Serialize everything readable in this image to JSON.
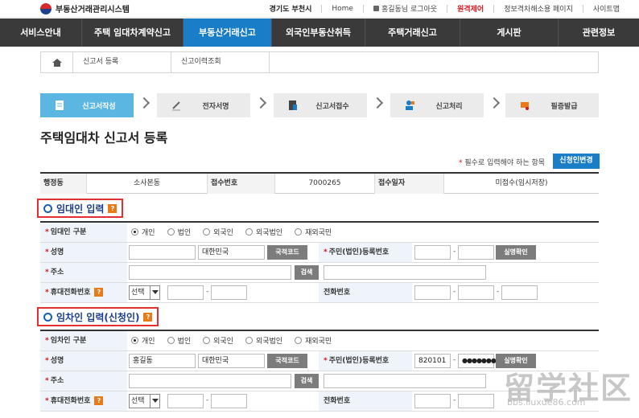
{
  "header": {
    "logo_text": "부동산거래관리시스템",
    "region": "경기도 부천시",
    "home": "Home",
    "user_logout": "홍길동님 로그아웃",
    "remote_control": "원격제어",
    "info_cancel": "정보격차해소용 페이지",
    "sitemap": "사이트맵"
  },
  "nav": {
    "items": [
      "서비스안내",
      "주택 임대차계약신고",
      "부동산거래신고",
      "외국인부동산취득",
      "주택거래신고",
      "게시판",
      "관련정보"
    ]
  },
  "breadcrumb": {
    "items": [
      "신고서 등록",
      "신고이력조회"
    ]
  },
  "steps": [
    "신고서작성",
    "전자서명",
    "신고서접수",
    "신고처리",
    "필증발급"
  ],
  "page": {
    "title": "주택임대차 신고서 등록",
    "required_note": "필수로 입력해야 하는 항목",
    "change_applicant": "신청인변경"
  },
  "info": {
    "admin_dong_label": "행정동",
    "admin_dong_value": "소사본동",
    "receipt_no_label": "접수번호",
    "receipt_no_value": "7000265",
    "receipt_date_label": "접수일자",
    "receipt_date_value": "미접수(임시저장)"
  },
  "lessor": {
    "title": "임대인 입력",
    "type_label": "임대인 구분",
    "types": [
      "개인",
      "법인",
      "외국인",
      "외국법인",
      "재외국민"
    ],
    "name_label": "성명",
    "name_value": "",
    "nationality": "대한민국",
    "nation_code_btn": "국적코드",
    "id_label": "주민(법인)등록번호",
    "id_front": "",
    "id_back": "",
    "verify_btn": "실명확인",
    "address_label": "주소",
    "search_btn": "검색",
    "mobile_label": "휴대전화번호",
    "select_value": "선택",
    "phone_label": "전화번호"
  },
  "lessee": {
    "title": "임차인 입력(신청인)",
    "type_label": "임차인 구분",
    "types": [
      "개인",
      "법인",
      "외국인",
      "외국법인",
      "재외국민"
    ],
    "name_label": "성명",
    "name_value": "홍길동",
    "nationality": "대한민국",
    "nation_code_btn": "국적코드",
    "id_label": "주민(법인)등록번호",
    "id_front": "820101",
    "id_back": "●●●●●●●",
    "verify_btn": "실명확인",
    "address_label": "주소",
    "search_btn": "검색",
    "mobile_label": "휴대전화번호",
    "select_value": "선택",
    "phone_label": "전화번호"
  },
  "help_glyph": "?",
  "watermark": {
    "big": "留学社区",
    "small": "bbs.liuxue86.com"
  }
}
